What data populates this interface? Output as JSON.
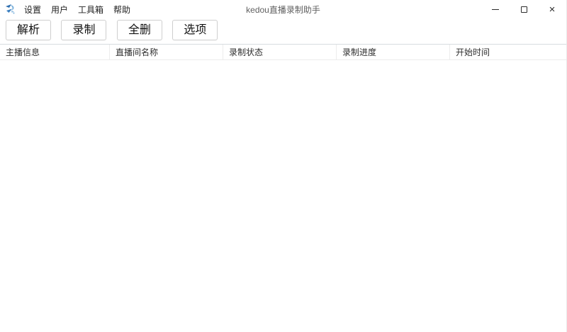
{
  "window": {
    "title": "kedou直播录制助手",
    "controls": {
      "minimize": "─",
      "maximize": "□",
      "close": "×"
    }
  },
  "menu": {
    "items": [
      {
        "label": "设置"
      },
      {
        "label": "用户"
      },
      {
        "label": "工具箱"
      },
      {
        "label": "帮助"
      }
    ]
  },
  "toolbar": {
    "buttons": [
      {
        "label": "解析"
      },
      {
        "label": "录制"
      },
      {
        "label": "全删"
      },
      {
        "label": "选项"
      }
    ]
  },
  "table": {
    "columns": [
      "主播信息",
      "直播间名称",
      "录制状态",
      "录制进度",
      "开始时间"
    ],
    "rows": []
  },
  "icons": {
    "app_logo": "kedou-tadpole-swirl",
    "minimize": "minimize-line",
    "maximize": "maximize-square",
    "close": "close-x"
  },
  "colors": {
    "logo_blue_dark": "#2e6fb0",
    "logo_blue_light": "#7ab1dc",
    "header_border_top": "#d7dce0",
    "header_border_bottom": "#ebebeb",
    "button_border": "#cfcfcf",
    "title_text": "#606060"
  }
}
